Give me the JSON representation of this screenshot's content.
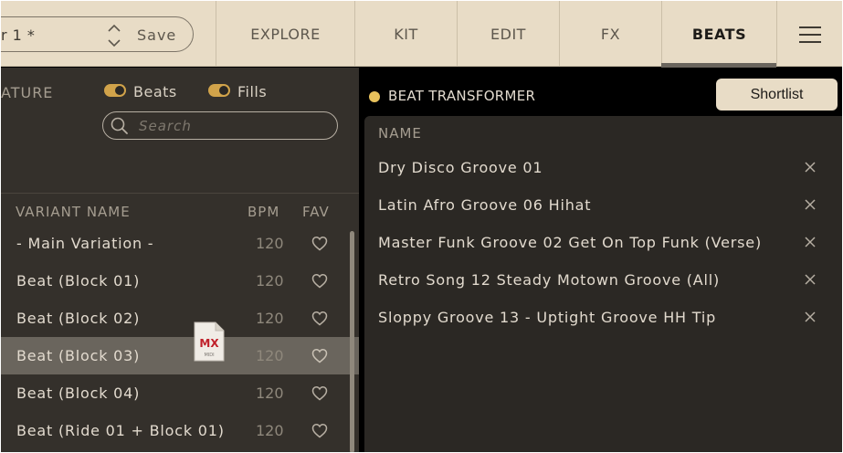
{
  "header": {
    "preset_name": "r 1 *",
    "save_label": "Save",
    "tabs": [
      {
        "label": "EXPLORE"
      },
      {
        "label": "KIT"
      },
      {
        "label": "EDIT"
      },
      {
        "label": "FX"
      },
      {
        "label": "BEATS"
      }
    ],
    "active_tab": "BEATS"
  },
  "filters": {
    "feature_label": "ATURE",
    "toggles": [
      {
        "label": "Beats",
        "on": true
      },
      {
        "label": "Fills",
        "on": true
      }
    ],
    "search_placeholder": "Search"
  },
  "variants": {
    "columns": {
      "name": "VARIANT NAME",
      "bpm": "BPM",
      "fav": "FAV"
    },
    "rows": [
      {
        "name": "- Main Variation -",
        "bpm": "120"
      },
      {
        "name": "Beat (Block 01)",
        "bpm": "120"
      },
      {
        "name": "Beat (Block 02)",
        "bpm": "120"
      },
      {
        "name": "Beat (Block 03)",
        "bpm": "120",
        "selected": true
      },
      {
        "name": "Beat (Block 04)",
        "bpm": "120"
      },
      {
        "name": "Beat (Ride 01 + Block 01)",
        "bpm": "120"
      }
    ],
    "drag_icon": {
      "badge": "MX",
      "label": "MIDI"
    }
  },
  "shortlist": {
    "title": "BEAT TRANSFORMER",
    "button_label": "Shortlist",
    "column": "NAME",
    "items": [
      {
        "name": "Dry Disco Groove 01"
      },
      {
        "name": "Latin Afro Groove 06 Hihat"
      },
      {
        "name": "Master Funk Groove 02 Get On Top Funk (Verse)"
      },
      {
        "name": "Retro Song 12 Steady Motown Groove (All)"
      },
      {
        "name": "Sloppy Groove 13 - Uptight Groove HH Tip"
      }
    ]
  },
  "colors": {
    "accent": "#d1a34a",
    "topbar": "#e8dcc6",
    "selected_row": "#6a655d",
    "indicator": "#e8c15c"
  }
}
